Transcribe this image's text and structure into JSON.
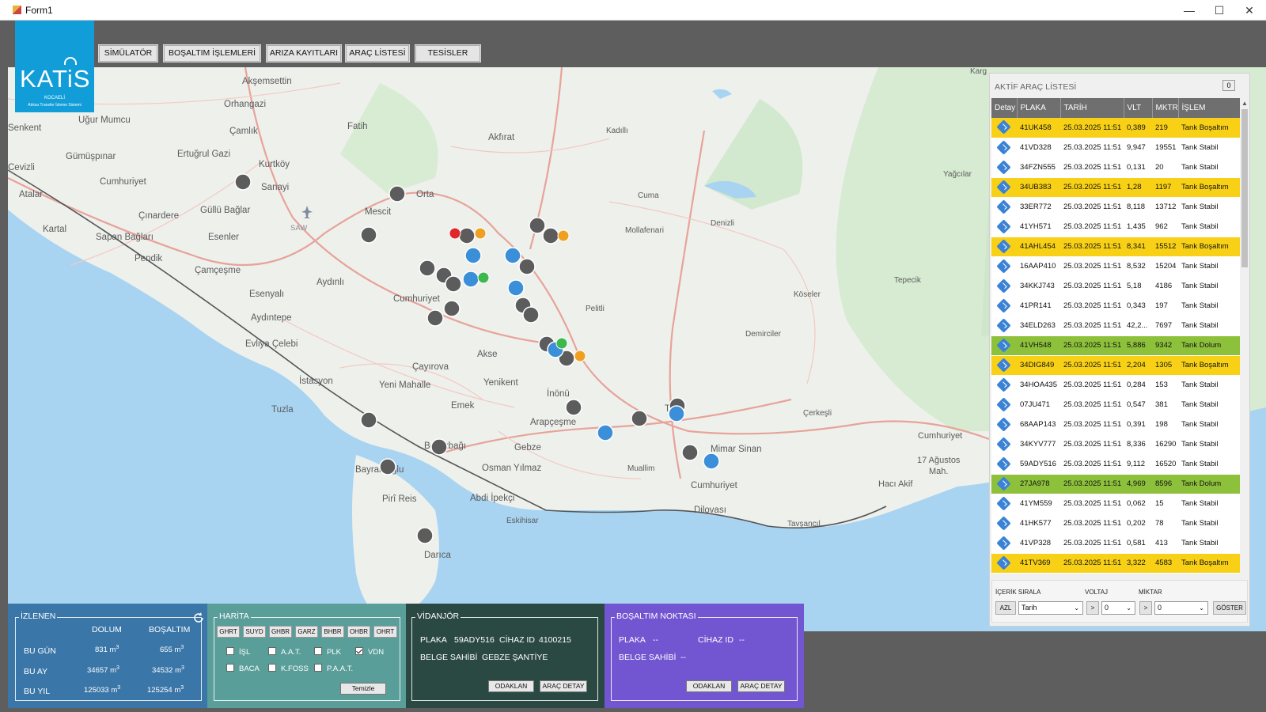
{
  "window": {
    "title": "Form1",
    "minimize": "—",
    "maximize": "☐",
    "close": "✕"
  },
  "logo": {
    "text": "KATiS",
    "tagline1": "KOCAELİ",
    "tagline2": "Atıksu Transfer İzleme Sistemi"
  },
  "nav": [
    {
      "label": "SİMÜLATÖR"
    },
    {
      "label": "BOŞALTIM İŞLEMLERİ"
    },
    {
      "label": "ARIZA KAYITLARI"
    },
    {
      "label": "ARAÇ LİSTESİ"
    },
    {
      "label": "TESİSLER"
    }
  ],
  "map": {
    "places": [
      {
        "name": "Akşemsettin"
      },
      {
        "name": "Orhangazi"
      },
      {
        "name": "Uğur Mumcu"
      },
      {
        "name": "Fatih"
      },
      {
        "name": "Senkent"
      },
      {
        "name": "Çamlık"
      },
      {
        "name": "Akfırat"
      },
      {
        "name": "Kadıllı"
      },
      {
        "name": "Yağcılar"
      },
      {
        "name": "Ertuğrul Gazi"
      },
      {
        "name": "Gümüşpınar"
      },
      {
        "name": "Kurtköy"
      },
      {
        "name": "Cevizli"
      },
      {
        "name": "Cumhuriyet"
      },
      {
        "name": "Sanayi"
      },
      {
        "name": "Orta"
      },
      {
        "name": "Cuma"
      },
      {
        "name": "Atalar"
      },
      {
        "name": "Güllü Bağlar"
      },
      {
        "name": "Mescit"
      },
      {
        "name": "Çınardere"
      },
      {
        "name": "SAW"
      },
      {
        "name": "Kartal"
      },
      {
        "name": "Sapan Bağları"
      },
      {
        "name": "Esenler"
      },
      {
        "name": "Denizli"
      },
      {
        "name": "Mollafenari"
      },
      {
        "name": "Pendik"
      },
      {
        "name": "Çamçeşme"
      },
      {
        "name": "Aydınlı"
      },
      {
        "name": "Tepecik"
      },
      {
        "name": "Esenyalı"
      },
      {
        "name": "Cumhuriyet"
      },
      {
        "name": "Pelitli"
      },
      {
        "name": "Köseler"
      },
      {
        "name": "Aydıntepe"
      },
      {
        "name": "Demirciler"
      },
      {
        "name": "Evliya Çelebi"
      },
      {
        "name": "Akse"
      },
      {
        "name": "Çayırova"
      },
      {
        "name": "İstasyon"
      },
      {
        "name": "Yenikent"
      },
      {
        "name": "Yeni Mahalle"
      },
      {
        "name": "İnönü"
      },
      {
        "name": "Emek"
      },
      {
        "name": "Tuzla"
      },
      {
        "name": "Arapçeşme"
      },
      {
        "name": "Tav"
      },
      {
        "name": "Çerkeşli"
      },
      {
        "name": "Cumhuriyet"
      },
      {
        "name": "Beylikbağı"
      },
      {
        "name": "Mimar Sinan"
      },
      {
        "name": "Gebze"
      },
      {
        "name": "17 Ağustos"
      },
      {
        "name": "Mah."
      },
      {
        "name": "Bayramoğlu"
      },
      {
        "name": "Osman Yılmaz"
      },
      {
        "name": "Muallim"
      },
      {
        "name": "Cumhuriyet"
      },
      {
        "name": "Hacı Akif"
      },
      {
        "name": "Pirî Reis"
      },
      {
        "name": "Abdi İpekçi"
      },
      {
        "name": "Dilovası"
      },
      {
        "name": "Eskihisar"
      },
      {
        "name": "Tavşancıl"
      },
      {
        "name": "Darıca"
      },
      {
        "name": "Karg"
      }
    ]
  },
  "active_list": {
    "title": "AKTİF ARAÇ LİSTESİ",
    "count_button": "0",
    "columns": [
      "Detay",
      "PLAKA",
      "TARİH",
      "VLT",
      "MKTR",
      "İŞLEM"
    ],
    "rows": [
      {
        "plaka": "41UK458",
        "tarih": "25.03.2025 11:51",
        "vlt": "0,389",
        "mktr": "219",
        "islem": "Tank Boşaltım",
        "status": "yellow"
      },
      {
        "plaka": "41VD328",
        "tarih": "25.03.2025 11:51",
        "vlt": "9,947",
        "mktr": "19551",
        "islem": "Tank Stabil",
        "status": "white"
      },
      {
        "plaka": "34FZN555",
        "tarih": "25.03.2025 11:51",
        "vlt": "0,131",
        "mktr": "20",
        "islem": "Tank Stabil",
        "status": "white"
      },
      {
        "plaka": "34UB383",
        "tarih": "25.03.2025 11:51",
        "vlt": "1,28",
        "mktr": "1197",
        "islem": "Tank Boşaltım",
        "status": "yellow"
      },
      {
        "plaka": "33ER772",
        "tarih": "25.03.2025 11:51",
        "vlt": "8,118",
        "mktr": "13712",
        "islem": "Tank Stabil",
        "status": "white"
      },
      {
        "plaka": "41YH571",
        "tarih": "25.03.2025 11:51",
        "vlt": "1,435",
        "mktr": "962",
        "islem": "Tank Stabil",
        "status": "white"
      },
      {
        "plaka": "41AHL454",
        "tarih": "25.03.2025 11:51",
        "vlt": "8,341",
        "mktr": "15512",
        "islem": "Tank Boşaltım",
        "status": "yellow"
      },
      {
        "plaka": "16AAP410",
        "tarih": "25.03.2025 11:51",
        "vlt": "8,532",
        "mktr": "15204",
        "islem": "Tank Stabil",
        "status": "white"
      },
      {
        "plaka": "34KKJ743",
        "tarih": "25.03.2025 11:51",
        "vlt": "5,18",
        "mktr": "4186",
        "islem": "Tank Stabil",
        "status": "white"
      },
      {
        "plaka": "41PR141",
        "tarih": "25.03.2025 11:51",
        "vlt": "0,343",
        "mktr": "197",
        "islem": "Tank Stabil",
        "status": "white"
      },
      {
        "plaka": "34ELD263",
        "tarih": "25.03.2025 11:51",
        "vlt": "42,2...",
        "mktr": "7697",
        "islem": "Tank Stabil",
        "status": "white"
      },
      {
        "plaka": "41VH548",
        "tarih": "25.03.2025 11:51",
        "vlt": "5,886",
        "mktr": "9342",
        "islem": "Tank Dolum",
        "status": "green"
      },
      {
        "plaka": "34DIG849",
        "tarih": "25.03.2025 11:51",
        "vlt": "2,204",
        "mktr": "1305",
        "islem": "Tank Boşaltım",
        "status": "yellow"
      },
      {
        "plaka": "34HOA435",
        "tarih": "25.03.2025 11:51",
        "vlt": "0,284",
        "mktr": "153",
        "islem": "Tank Stabil",
        "status": "white"
      },
      {
        "plaka": "07JU471",
        "tarih": "25.03.2025 11:51",
        "vlt": "0,547",
        "mktr": "381",
        "islem": "Tank Stabil",
        "status": "white"
      },
      {
        "plaka": "68AAP143",
        "tarih": "25.03.2025 11:51",
        "vlt": "0,391",
        "mktr": "198",
        "islem": "Tank Stabil",
        "status": "white"
      },
      {
        "plaka": "34KYV777",
        "tarih": "25.03.2025 11:51",
        "vlt": "8,336",
        "mktr": "16290",
        "islem": "Tank Stabil",
        "status": "white"
      },
      {
        "plaka": "59ADY516",
        "tarih": "25.03.2025 11:51",
        "vlt": "9,112",
        "mktr": "16520",
        "islem": "Tank Stabil",
        "status": "white"
      },
      {
        "plaka": "27JA978",
        "tarih": "25.03.2025 11:51",
        "vlt": "4,969",
        "mktr": "8596",
        "islem": "Tank Dolum",
        "status": "green"
      },
      {
        "plaka": "41YM559",
        "tarih": "25.03.2025 11:51",
        "vlt": "0,062",
        "mktr": "15",
        "islem": "Tank Stabil",
        "status": "white"
      },
      {
        "plaka": "41HK577",
        "tarih": "25.03.2025 11:51",
        "vlt": "0,202",
        "mktr": "78",
        "islem": "Tank Stabil",
        "status": "white"
      },
      {
        "plaka": "41VP328",
        "tarih": "25.03.2025 11:51",
        "vlt": "0,581",
        "mktr": "413",
        "islem": "Tank Stabil",
        "status": "white"
      },
      {
        "plaka": "41TV369",
        "tarih": "25.03.2025 11:51",
        "vlt": "3,322",
        "mktr": "4583",
        "islem": "Tank Boşaltım",
        "status": "yellow"
      }
    ],
    "sort": {
      "label_sort": "İÇERİK SIRALA",
      "label_voltage": "VOLTAJ",
      "label_amount": "MİKTAR",
      "dir_button": "AZL",
      "sort_field": "Tarih",
      "voltage_op": ">",
      "voltage_value": "0",
      "amount_op": ">",
      "amount_value": "0",
      "show_button": "GÖSTER"
    }
  },
  "izlenen": {
    "legend": "İZLENEN",
    "col_dolum": "DOLUM",
    "col_bosaltim": "BOŞALTIM",
    "unit": "m",
    "unit_exp": "3",
    "rows": [
      {
        "label": "BU GÜN",
        "dolum": "831",
        "bosaltim": "655"
      },
      {
        "label": "BU AY",
        "dolum": "34657",
        "bosaltim": "34532"
      },
      {
        "label": "BU YIL",
        "dolum": "125033",
        "bosaltim": "125254"
      }
    ]
  },
  "harita": {
    "legend": "HARİTA",
    "buttons": [
      "GHRT",
      "SUYD",
      "GHBR",
      "GARZ",
      "BHBR",
      "OHBR",
      "OHRT"
    ],
    "checks": [
      {
        "label": "İŞL",
        "checked": false
      },
      {
        "label": "A.A.T.",
        "checked": false
      },
      {
        "label": "PLK",
        "checked": false
      },
      {
        "label": "VDN",
        "checked": true
      },
      {
        "label": "BACA",
        "checked": false
      },
      {
        "label": "K.FOSS",
        "checked": false
      },
      {
        "label": "P.A.A.T.",
        "checked": false
      }
    ],
    "clear_button": "Temizle"
  },
  "vidanjor": {
    "legend": "VİDANJÖR",
    "plaka_label": "PLAKA",
    "plaka": "59ADY516",
    "cihaz_label": "CİHAZ ID",
    "cihaz": "4100215",
    "belge_label": "BELGE SAHİBİ",
    "belge": "GEBZE ŞANTİYE",
    "focus_button": "ODAKLAN",
    "detail_button": "ARAÇ DETAY"
  },
  "bosaltim_noktasi": {
    "legend": "BOŞALTIM NOKTASI",
    "plaka_label": "PLAKA",
    "plaka": "--",
    "cihaz_label": "CİHAZ ID",
    "cihaz": "--",
    "belge_label": "BELGE SAHİBİ",
    "belge": "--",
    "focus_button": "ODAKLAN",
    "detail_button": "ARAÇ DETAY"
  },
  "colors": {
    "brand": "#119dd8",
    "row_yellow": "#f8d117",
    "row_green": "#8ec13b",
    "izlenen_bg": "#3a76a8",
    "harita_bg": "#5a9e99",
    "vidanjor_bg": "#2b4943",
    "bosaltim_bg": "#7256d1",
    "sea": "#a8d4f2",
    "land": "#eef0ec"
  }
}
